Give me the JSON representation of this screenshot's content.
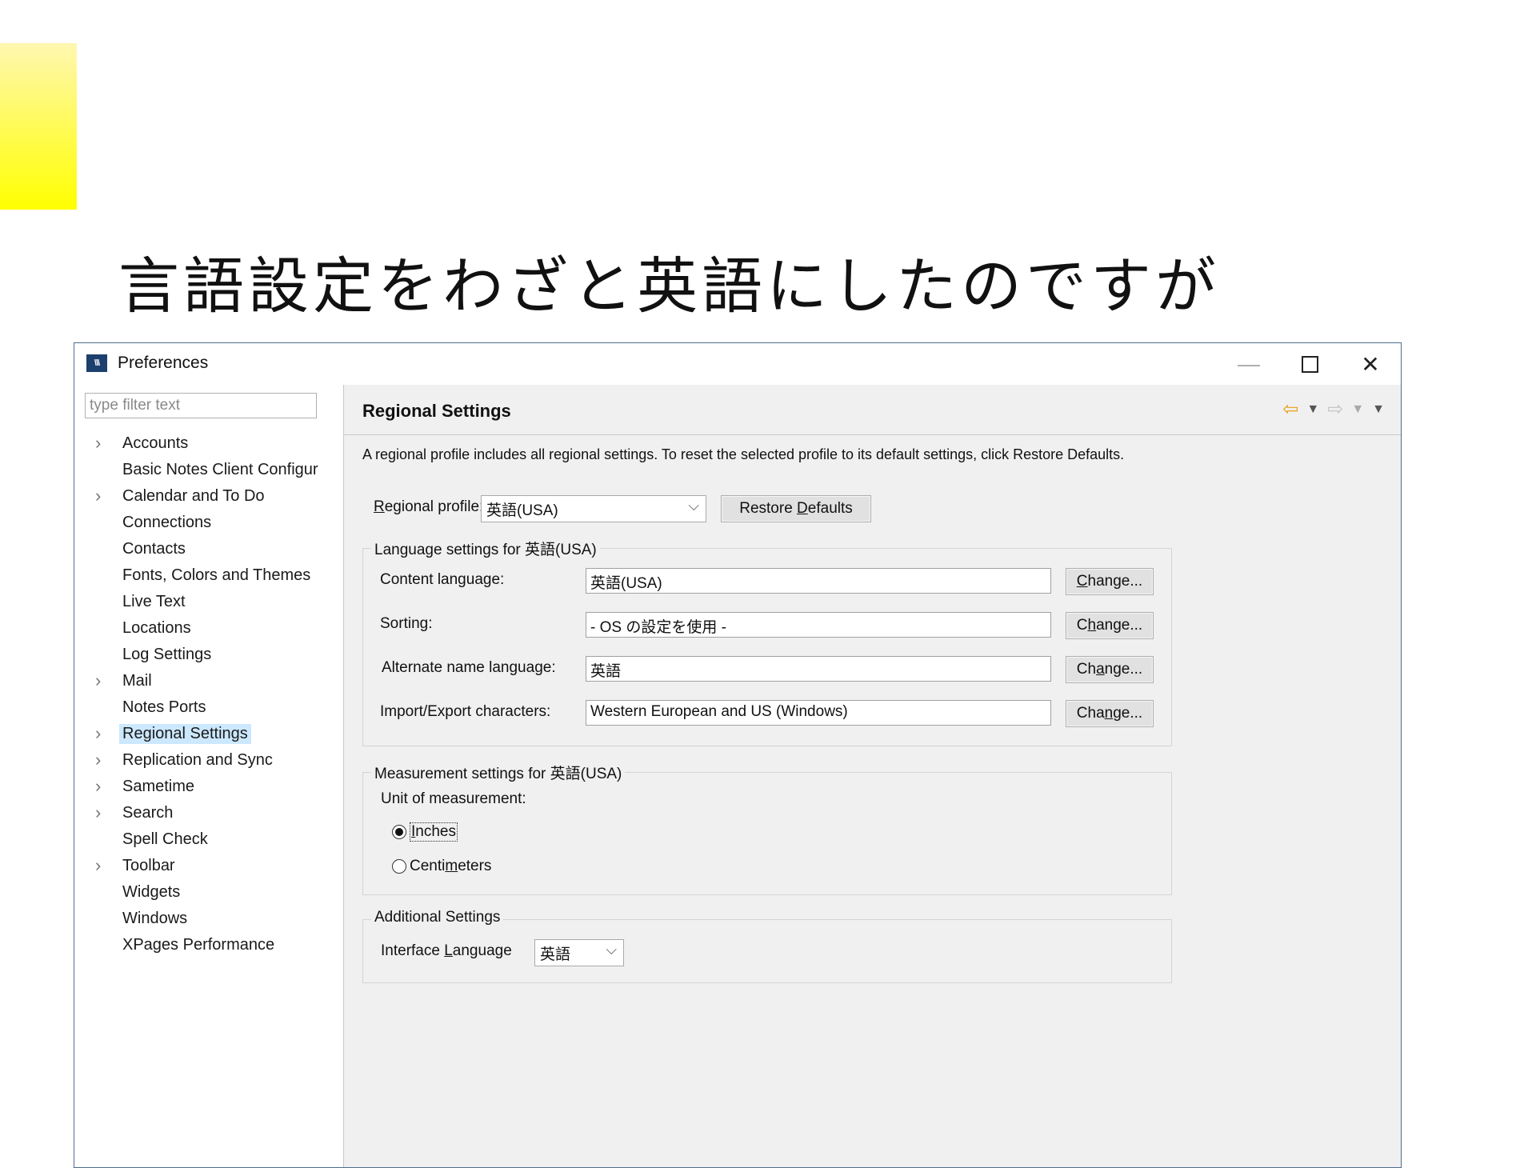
{
  "slide": {
    "title": "言語設定をわざと英語にしたのですが",
    "accent_color": "#ffff00"
  },
  "window": {
    "title": "Preferences",
    "icon": "notes-app-icon",
    "controls": [
      "minimize-icon",
      "maximize-icon",
      "close-icon"
    ]
  },
  "sidebar": {
    "filter_placeholder": "type filter text",
    "items": [
      {
        "label": "Accounts",
        "expandable": true
      },
      {
        "label": "Basic Notes Client Configur",
        "expandable": false
      },
      {
        "label": "Calendar and To Do",
        "expandable": true
      },
      {
        "label": "Connections",
        "expandable": false
      },
      {
        "label": "Contacts",
        "expandable": false
      },
      {
        "label": "Fonts, Colors and Themes",
        "expandable": false
      },
      {
        "label": "Live Text",
        "expandable": false
      },
      {
        "label": "Locations",
        "expandable": false
      },
      {
        "label": "Log Settings",
        "expandable": false
      },
      {
        "label": "Mail",
        "expandable": true
      },
      {
        "label": "Notes Ports",
        "expandable": false
      },
      {
        "label": "Regional Settings",
        "expandable": true,
        "selected": true
      },
      {
        "label": "Replication and Sync",
        "expandable": true
      },
      {
        "label": "Sametime",
        "expandable": true
      },
      {
        "label": "Search",
        "expandable": true
      },
      {
        "label": "Spell Check",
        "expandable": false
      },
      {
        "label": "Toolbar",
        "expandable": true
      },
      {
        "label": "Widgets",
        "expandable": false
      },
      {
        "label": "Windows",
        "expandable": false
      },
      {
        "label": "XPages Performance",
        "expandable": false
      }
    ]
  },
  "main": {
    "title": "Regional Settings",
    "description": "A regional profile includes all regional settings.  To reset the selected profile to its default settings, click Restore Defaults.",
    "profile": {
      "label": "Regional profile:",
      "value": "英語(USA)",
      "restore_label": "Restore Defaults"
    },
    "language_group": {
      "legend": "Language settings for 英語(USA)",
      "rows": [
        {
          "label": "Content language:",
          "value": "英語(USA)",
          "button": "Change..."
        },
        {
          "label": "Sorting:",
          "value": "- OS の設定を使用 -",
          "button": "Change..."
        },
        {
          "label": "Alternate name language:",
          "value": "英語",
          "button": "Change..."
        },
        {
          "label": "Import/Export characters:",
          "value": "Western European and US (Windows)",
          "button": "Change..."
        }
      ]
    },
    "measurement_group": {
      "legend": "Measurement settings for 英語(USA)",
      "unit_label": "Unit of measurement:",
      "options": [
        {
          "label": "Inches",
          "checked": true
        },
        {
          "label": "Centimeters",
          "checked": false
        }
      ]
    },
    "additional_group": {
      "legend": "Additional Settings",
      "interface_label": "Interface Language",
      "interface_value": "英語"
    }
  }
}
